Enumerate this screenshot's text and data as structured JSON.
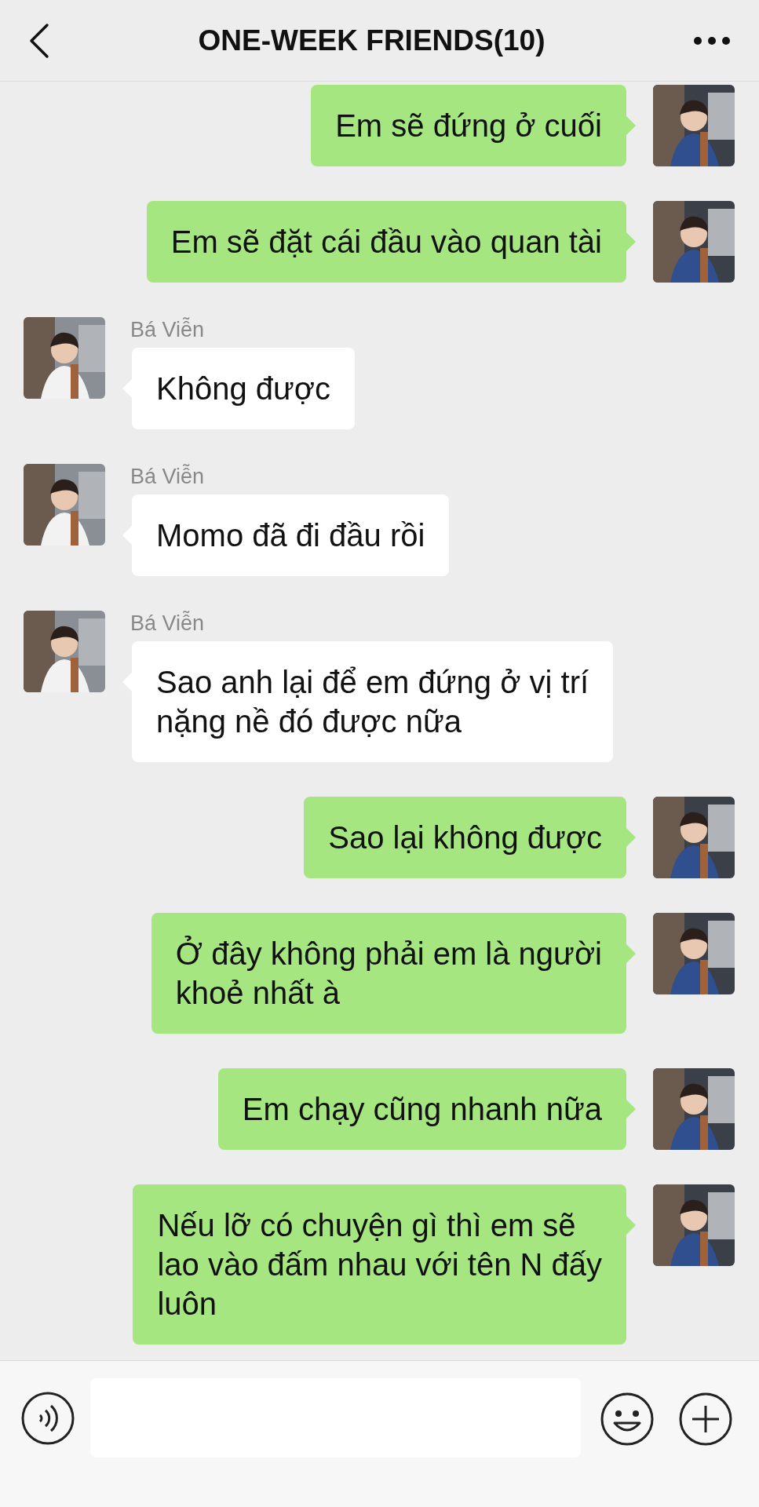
{
  "header": {
    "title": "ONE-WEEK FRIENDS(10)"
  },
  "messages": [
    {
      "kind": "outgoing",
      "lines": [
        "Em sẽ đứng ở cuối"
      ]
    },
    {
      "kind": "outgoing",
      "lines": [
        "Em sẽ đặt cái đầu vào quan tài"
      ]
    },
    {
      "kind": "incoming",
      "sender": "Bá Viễn",
      "lines": [
        "Không được"
      ]
    },
    {
      "kind": "incoming",
      "sender": "Bá Viễn",
      "lines": [
        "Momo đã đi đầu rồi"
      ]
    },
    {
      "kind": "incoming",
      "sender": "Bá Viễn",
      "lines": [
        "Sao anh lại để em đứng ở vị trí",
        "nặng nề đó được nữa"
      ]
    },
    {
      "kind": "outgoing",
      "lines": [
        "Sao lại không được"
      ]
    },
    {
      "kind": "outgoing",
      "lines": [
        "Ở đây không phải em là người",
        "khoẻ nhất à"
      ]
    },
    {
      "kind": "outgoing",
      "lines": [
        "Em chạy cũng nhanh nữa"
      ]
    },
    {
      "kind": "outgoing",
      "lines": [
        "Nếu lỡ có chuyện gì thì em sẽ",
        "lao vào đấm nhau với tên N đấy",
        "luôn"
      ]
    }
  ]
}
